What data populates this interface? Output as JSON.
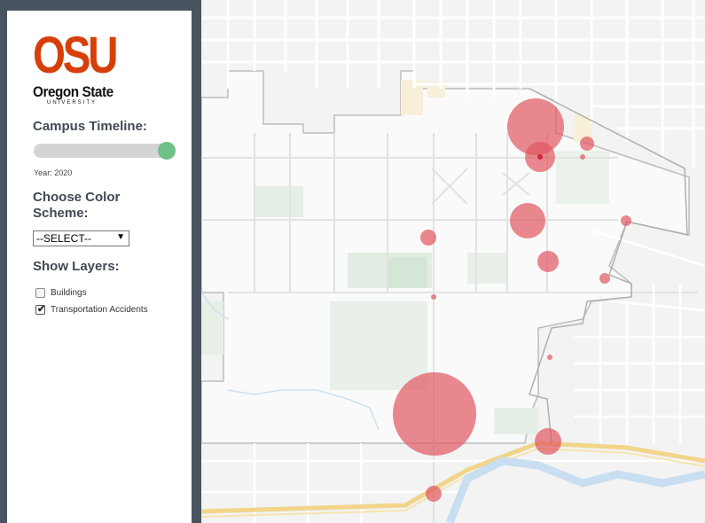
{
  "logo": {
    "wordmark": "OSU",
    "name": "Oregon State",
    "sub": "UNIVERSITY"
  },
  "timeline": {
    "title": "Campus Timeline:",
    "year_label": "Year:",
    "year": "2020",
    "value": 1.0
  },
  "color_scheme": {
    "title": "Choose Color Scheme:",
    "selected": "--SELECT--"
  },
  "layers": {
    "title": "Show Layers:",
    "items": [
      {
        "label": "Buildings",
        "checked": false
      },
      {
        "label": "Transportation Accidents",
        "checked": true
      }
    ]
  },
  "colors": {
    "accent": "#d73f09",
    "slider_thumb": "#6ec186",
    "accident_marker": "#e05560",
    "sidebar_frame": "#4a5460"
  }
}
